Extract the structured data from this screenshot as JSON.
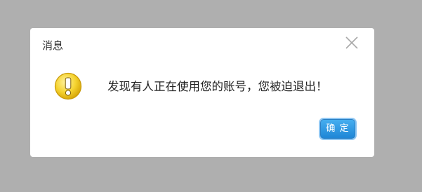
{
  "dialog": {
    "title": "消息",
    "message": "发现有人正在使用您的账号，您被迫退出！",
    "confirm_label": "确 定",
    "icon": "warning-icon",
    "close_icon": "close-icon"
  },
  "colors": {
    "backdrop": "#afafaf",
    "dialog_background": "#ffffff",
    "button_primary": "#2a93e0",
    "warning_icon": "#f3c523"
  }
}
